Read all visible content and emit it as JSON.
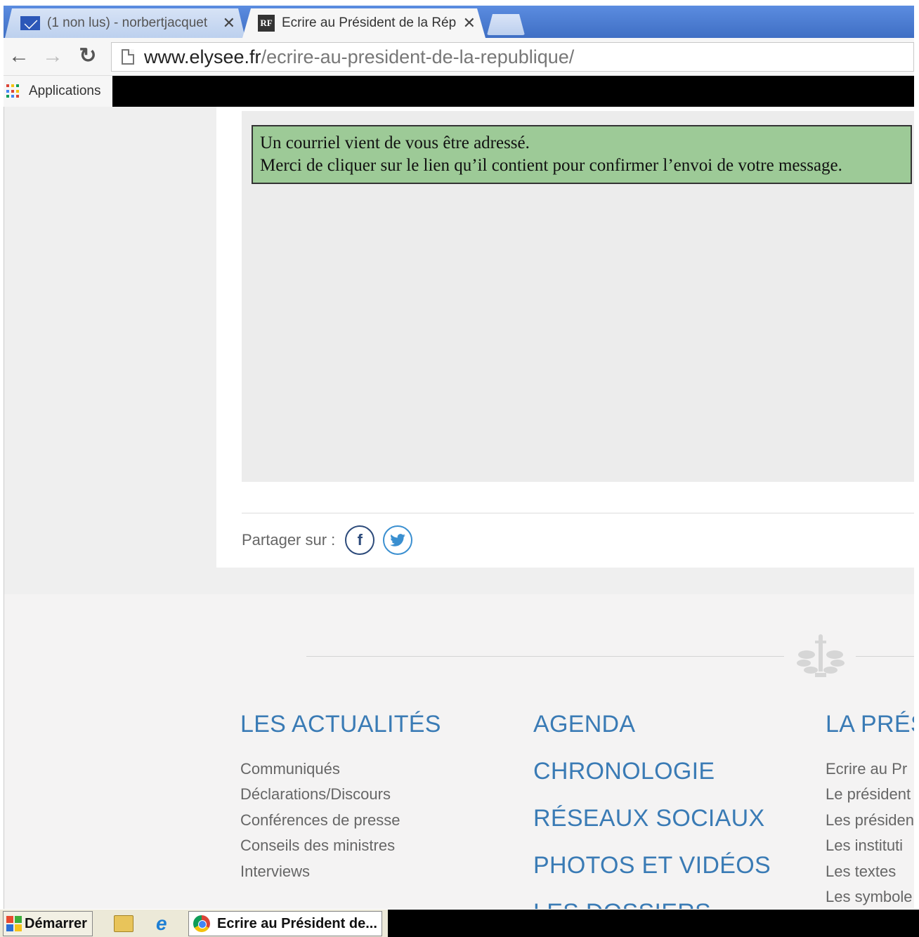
{
  "browser": {
    "tabs": [
      {
        "title": "(1 non lus) - norbertjacquet",
        "close": "✕"
      },
      {
        "title": "Ecrire au Président de la Rép",
        "close": "✕"
      }
    ],
    "url_host": "www.elysee.fr",
    "url_path": "/ecrire-au-president-de-la-republique/",
    "bookmarks": {
      "apps_label": "Applications"
    }
  },
  "page": {
    "notice": {
      "line1": "Un courriel vient de vous être adressé.",
      "line2": "Merci de cliquer sur le lien qu’il contient pour confirmer l’envoi de votre message."
    },
    "share": {
      "label": "Partager sur :"
    }
  },
  "footer": {
    "col1": {
      "title": "LES ACTUALITÉS",
      "links": [
        "Communiqués",
        "Déclarations/Discours",
        "Conférences de presse",
        "Conseils des ministres",
        "Interviews"
      ]
    },
    "col2": {
      "titles": [
        "AGENDA",
        "CHRONOLOGIE",
        "RÉSEAUX SOCIAUX",
        "PHOTOS ET VIDÉOS",
        "LES DOSSIERS"
      ]
    },
    "col3": {
      "title": "LA PRÉS",
      "links": [
        "Ecrire au Pr",
        "Le président",
        "Les présiden",
        "Les instituti",
        "Les textes",
        "Les symbole"
      ]
    }
  },
  "taskbar": {
    "start_label": "Démarrer",
    "task_label": "Ecrire au Président de..."
  },
  "colors": {
    "notice_bg": "#9dca97",
    "footer_heading": "#3a7bb5",
    "tabstrip": "#4a7bd0"
  }
}
